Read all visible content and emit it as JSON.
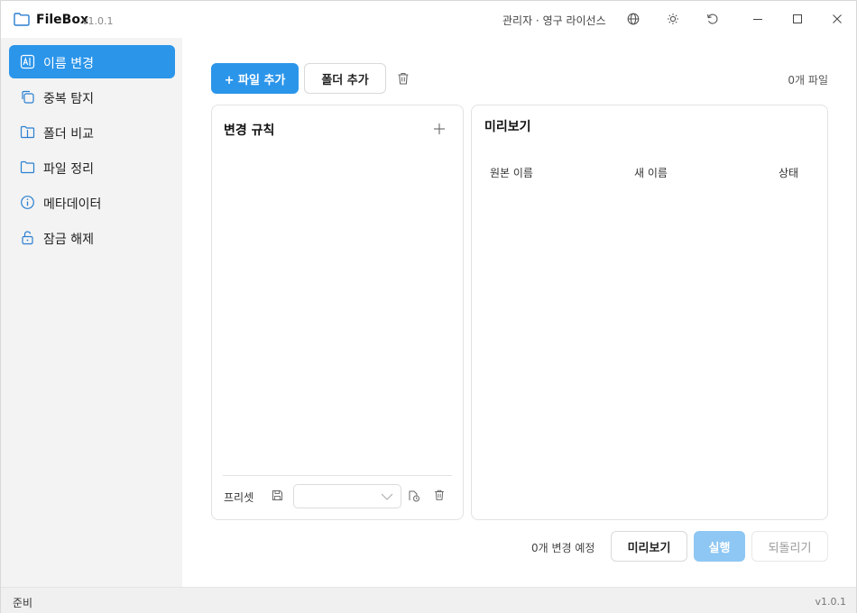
{
  "app": {
    "title": "FileBox",
    "version": "v1.0.1"
  },
  "titlebar": {
    "license": "관리자 · 영구 라이선스"
  },
  "sidebar": {
    "items": [
      {
        "label": "이름 변경",
        "icon": "rename-icon",
        "active": true
      },
      {
        "label": "중복 탐지",
        "icon": "duplicate-icon",
        "active": false
      },
      {
        "label": "폴더 비교",
        "icon": "folder-compare-icon",
        "active": false
      },
      {
        "label": "파일 정리",
        "icon": "folder-icon",
        "active": false
      },
      {
        "label": "메타데이터",
        "icon": "info-icon",
        "active": false
      },
      {
        "label": "잠금 해제",
        "icon": "unlock-icon",
        "active": false
      }
    ]
  },
  "toolbar": {
    "add_file": "+ 파일 추가",
    "add_folder": "폴더 추가",
    "file_count": "0개 파일"
  },
  "rules": {
    "title": "변경 규칙",
    "preset_label": "프리셋",
    "preset_value": ""
  },
  "preview": {
    "title": "미리보기",
    "columns": [
      "원본 이름",
      "새 이름",
      "상태"
    ]
  },
  "actions": {
    "pending": "0개 변경 예정",
    "preview": "미리보기",
    "run": "실행",
    "undo": "되돌리기"
  },
  "status": {
    "text": "준비",
    "version": "v1.0.1"
  },
  "colors": {
    "accent": "#2b95ea",
    "accent_disabled": "#8ec7f3",
    "sidebar_bg": "#f3f3f3"
  }
}
